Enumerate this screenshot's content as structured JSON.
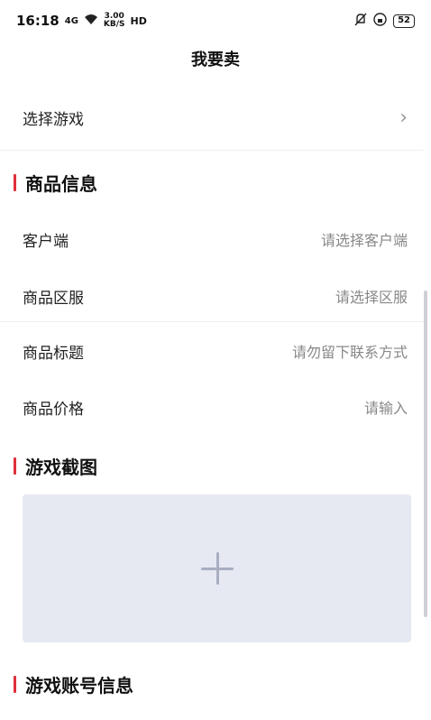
{
  "status_bar": {
    "time": "16:18",
    "signal": "4G",
    "speed_value": "3.00",
    "speed_unit": "KB/S",
    "hd": "HD",
    "battery": "52"
  },
  "nav": {
    "title": "我要卖"
  },
  "select_game": {
    "label": "选择游戏",
    "chevron": "›"
  },
  "sections": {
    "product_info": "商品信息",
    "screenshots": "游戏截图",
    "account_info": "游戏账号信息"
  },
  "product_fields": [
    {
      "label": "客户端",
      "placeholder": "请选择客户端"
    },
    {
      "label": "商品区服",
      "placeholder": "请选择区服"
    },
    {
      "label": "商品标题",
      "placeholder": "请勿留下联系方式"
    },
    {
      "label": "商品价格",
      "placeholder": "请输入"
    }
  ],
  "colors": {
    "accent": "#e0303a",
    "upload_bg": "#e6e9f2"
  }
}
